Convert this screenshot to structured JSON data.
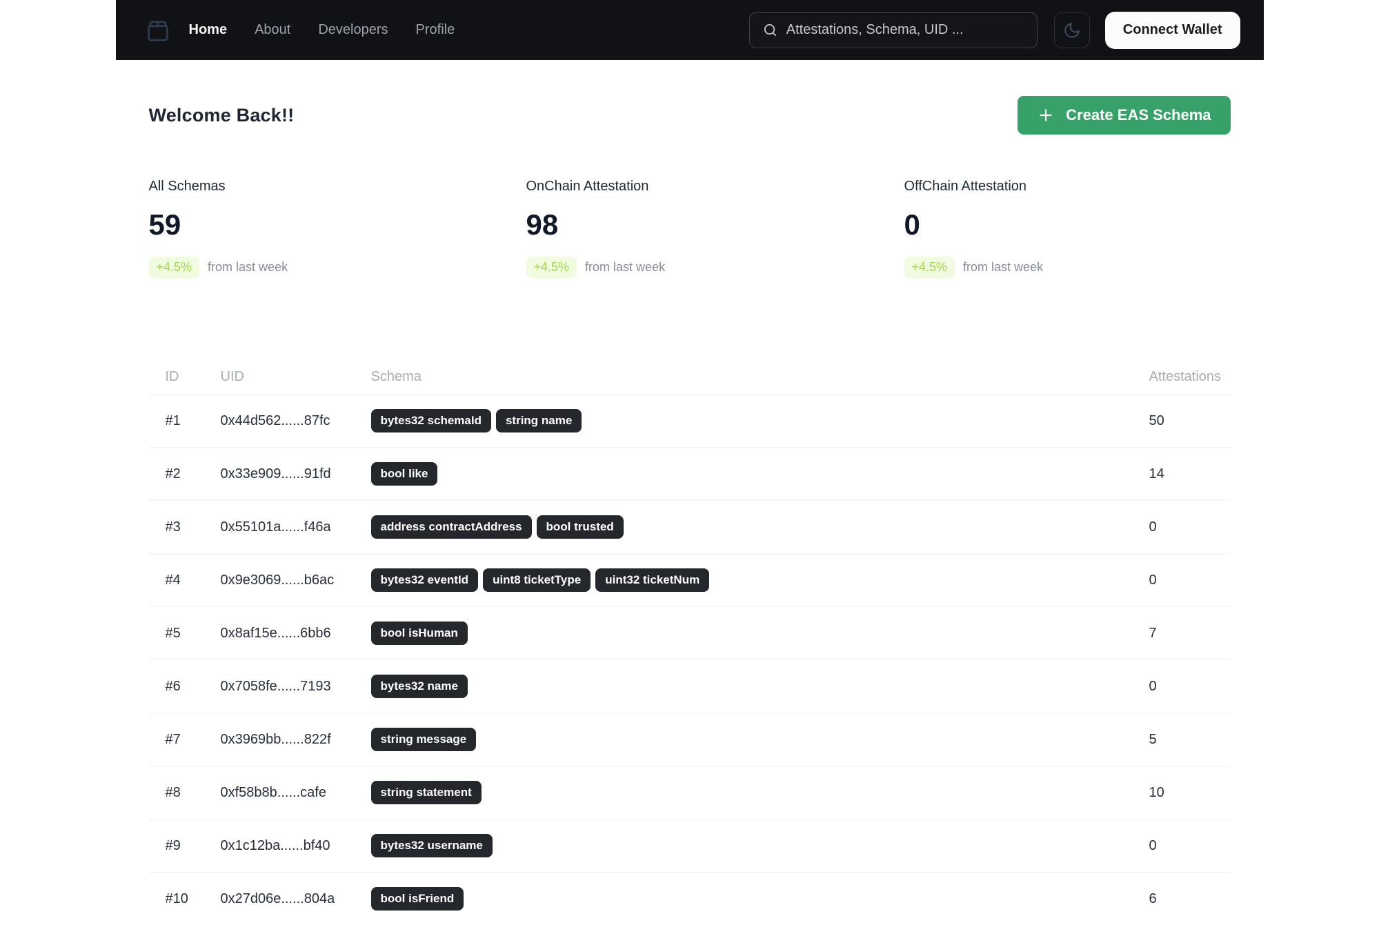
{
  "navbar": {
    "logo_icon": "package-icon",
    "items": [
      "Home",
      "About",
      "Developers",
      "Profile"
    ],
    "active_item": "Home",
    "search_placeholder": "Attestations, Schema, UID ...",
    "theme_toggle_icon": "moon-icon",
    "connect_wallet_label": "Connect Wallet"
  },
  "header": {
    "title": "Welcome Back!!",
    "create_button_label": "Create EAS Schema",
    "create_button_icon": "plus-icon"
  },
  "stats": [
    {
      "label": "All Schemas",
      "value": "59",
      "delta": "+4.5%",
      "note": "from last week"
    },
    {
      "label": "OnChain Attestation",
      "value": "98",
      "delta": "+4.5%",
      "note": "from last week"
    },
    {
      "label": "OffChain Attestation",
      "value": "0",
      "delta": "+4.5%",
      "note": "from last week"
    }
  ],
  "table": {
    "columns": [
      "ID",
      "UID",
      "Schema",
      "Attestations"
    ],
    "rows": [
      {
        "id": "#1",
        "uid": "0x44d562......87fc",
        "schema": [
          "bytes32 schemaId",
          "string name"
        ],
        "attestations": "50"
      },
      {
        "id": "#2",
        "uid": "0x33e909......91fd",
        "schema": [
          "bool like"
        ],
        "attestations": "14"
      },
      {
        "id": "#3",
        "uid": "0x55101a......f46a",
        "schema": [
          "address contractAddress",
          "bool trusted"
        ],
        "attestations": "0"
      },
      {
        "id": "#4",
        "uid": "0x9e3069......b6ac",
        "schema": [
          "bytes32 eventId",
          "uint8 ticketType",
          "uint32 ticketNum"
        ],
        "attestations": "0"
      },
      {
        "id": "#5",
        "uid": "0x8af15e......6bb6",
        "schema": [
          "bool isHuman"
        ],
        "attestations": "7"
      },
      {
        "id": "#6",
        "uid": "0x7058fe......7193",
        "schema": [
          "bytes32 name"
        ],
        "attestations": "0"
      },
      {
        "id": "#7",
        "uid": "0x3969bb......822f",
        "schema": [
          "string message"
        ],
        "attestations": "5"
      },
      {
        "id": "#8",
        "uid": "0xf58b8b......cafe",
        "schema": [
          "string statement"
        ],
        "attestations": "10"
      },
      {
        "id": "#9",
        "uid": "0x1c12ba......bf40",
        "schema": [
          "bytes32 username"
        ],
        "attestations": "0"
      },
      {
        "id": "#10",
        "uid": "0x27d06e......804a",
        "schema": [
          "bool isFriend"
        ],
        "attestations": "6"
      }
    ]
  },
  "colors": {
    "navbar_bg": "#101216",
    "accent_green": "#38a169",
    "delta_bg": "#f1fbdf",
    "delta_text": "#a0d949",
    "pill_bg": "#24272c",
    "row_border": "#edf0f5"
  }
}
